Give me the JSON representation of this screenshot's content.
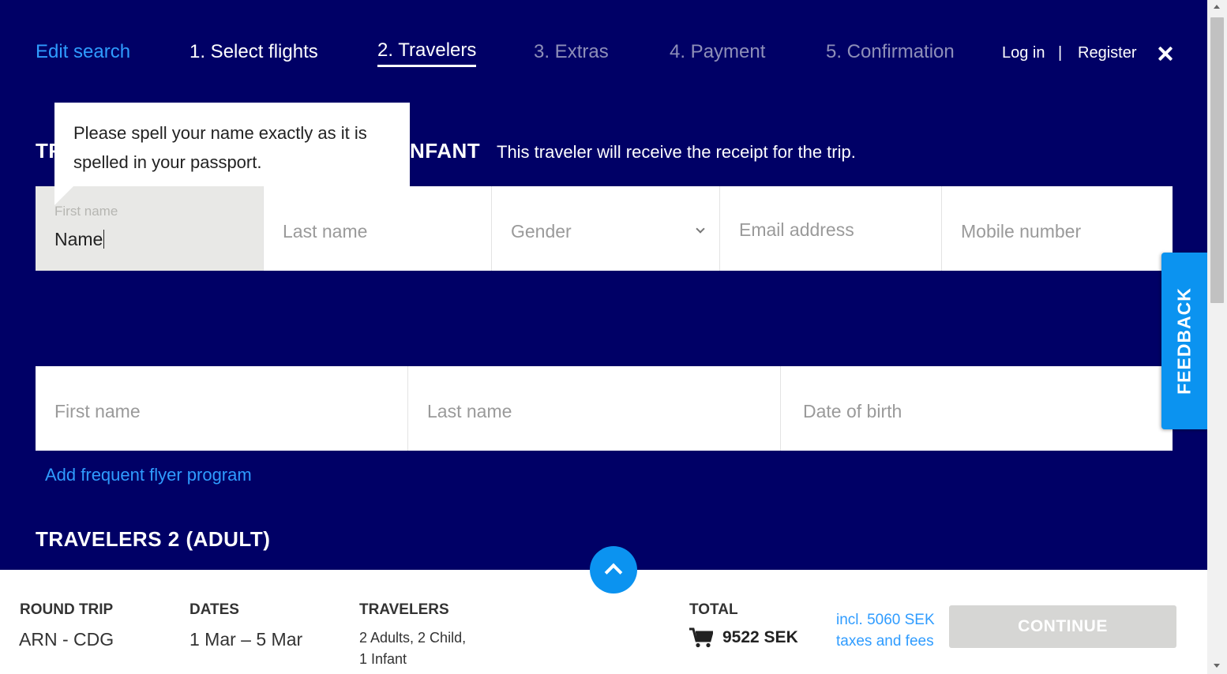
{
  "nav": {
    "edit_search": "Edit search",
    "steps": [
      "1. Select flights",
      "2. Travelers",
      "3. Extras",
      "4. Payment",
      "5. Confirmation"
    ],
    "login": "Log in",
    "separator": "|",
    "register": "Register",
    "close_icon": "close-icon"
  },
  "section": {
    "heading_left": "TR",
    "heading_right": "NFANT",
    "note": "This traveler will receive the receipt for the trip."
  },
  "tooltip": {
    "text": "Please spell your name exactly as it is spelled in your passport."
  },
  "row1": {
    "first_name_label": "First name",
    "first_name_value": "Name",
    "last_name_placeholder": "Last name",
    "gender_placeholder": "Gender",
    "email_placeholder": "Email address",
    "mobile_placeholder": "Mobile number"
  },
  "row2": {
    "first_name_placeholder": "First name",
    "last_name_placeholder": "Last name",
    "dob_placeholder": "Date of birth"
  },
  "add_ffp": "Add frequent flyer program",
  "travelers2_heading": "TRAVELERS 2 (ADULT)",
  "feedback": "FEEDBACK",
  "summary": {
    "trip_label": "ROUND TRIP",
    "trip_value": "ARN - CDG",
    "dates_label": "DATES",
    "dates_value": "1 Mar – 5 Mar",
    "travelers_label": "TRAVELERS",
    "travelers_line1": "2 Adults, 2 Child,",
    "travelers_line2": "1 Infant",
    "total_label": "TOTAL",
    "total_value": "9522 SEK",
    "taxes_line1": "incl. 5060 SEK",
    "taxes_line2": "taxes and fees",
    "continue": "CONTINUE"
  },
  "colors": {
    "background": "#000066",
    "accent": "#0b93f0",
    "link": "#2f9cff"
  }
}
